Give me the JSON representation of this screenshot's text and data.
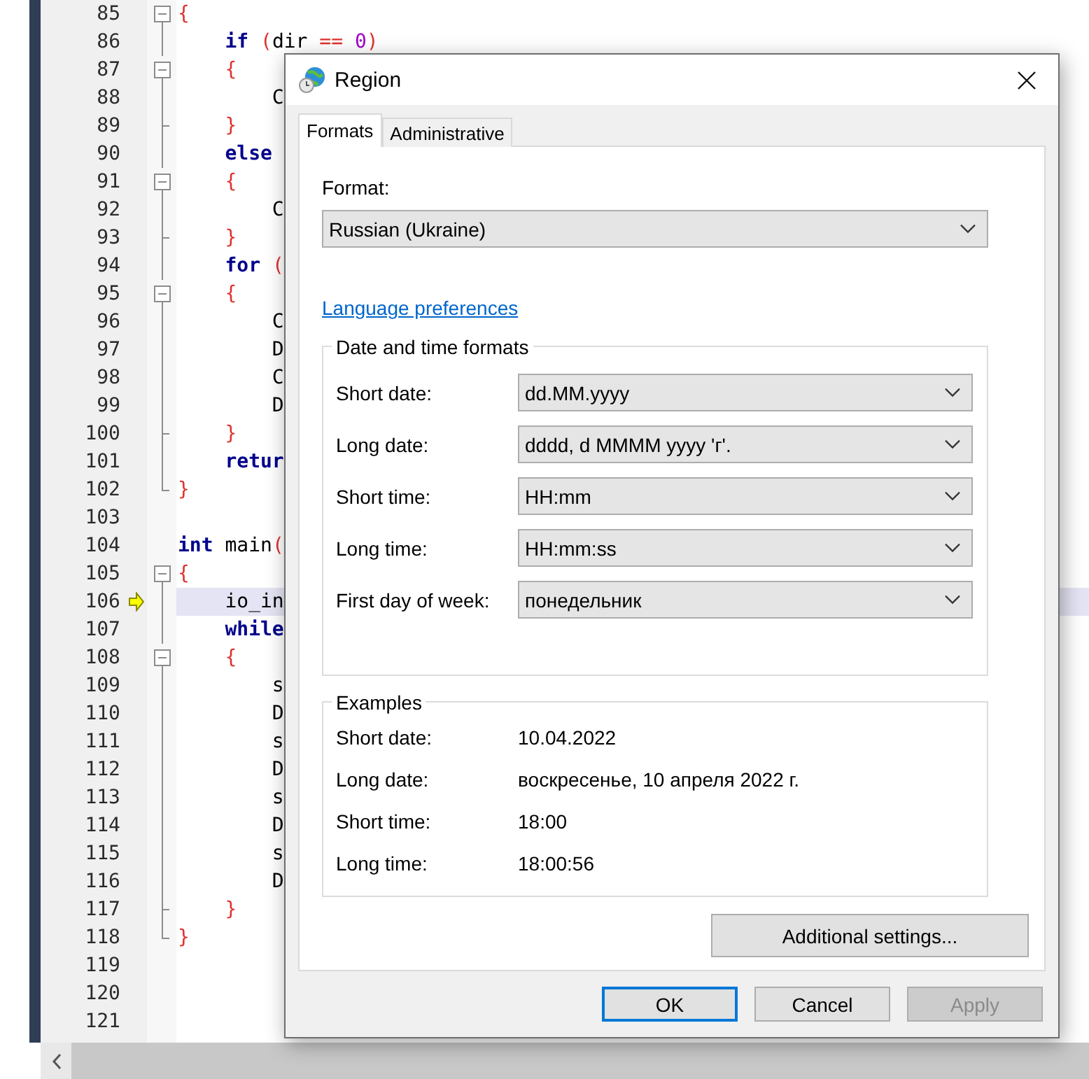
{
  "editor": {
    "lines": [
      {
        "number": "85",
        "current": false,
        "fold": {
          "kind": "start"
        },
        "tokens": [
          {
            "text": "{",
            "kind": "brace"
          }
        ]
      },
      {
        "number": "86",
        "current": false,
        "fold": {
          "kind": "mid"
        },
        "tokens": [
          {
            "text": "    if",
            "kind": "keyword"
          },
          {
            "text": " (",
            "kind": "brace"
          },
          {
            "text": "dir",
            "kind": "plain"
          },
          {
            "text": " ==",
            "kind": "brace"
          },
          {
            "text": " 0",
            "kind": "number"
          },
          {
            "text": ")",
            "kind": "brace"
          }
        ]
      },
      {
        "number": "87",
        "current": false,
        "fold": {
          "kind": "start"
        },
        "tokens": [
          {
            "text": "    {",
            "kind": "brace"
          }
        ]
      },
      {
        "number": "88",
        "current": false,
        "fold": {
          "kind": "mid"
        },
        "tokens": [
          {
            "text": "        C",
            "kind": "plain"
          }
        ]
      },
      {
        "number": "89",
        "current": false,
        "fold": {
          "kind": "end"
        },
        "tokens": [
          {
            "text": "    }",
            "kind": "brace"
          }
        ]
      },
      {
        "number": "90",
        "current": false,
        "fold": {
          "kind": "mid"
        },
        "tokens": [
          {
            "text": "    else",
            "kind": "keyword"
          }
        ]
      },
      {
        "number": "91",
        "current": false,
        "fold": {
          "kind": "start"
        },
        "tokens": [
          {
            "text": "    {",
            "kind": "brace"
          }
        ]
      },
      {
        "number": "92",
        "current": false,
        "fold": {
          "kind": "mid"
        },
        "tokens": [
          {
            "text": "        C",
            "kind": "plain"
          }
        ]
      },
      {
        "number": "93",
        "current": false,
        "fold": {
          "kind": "end"
        },
        "tokens": [
          {
            "text": "    }",
            "kind": "brace"
          }
        ]
      },
      {
        "number": "94",
        "current": false,
        "fold": {
          "kind": "mid"
        },
        "tokens": [
          {
            "text": "    for",
            "kind": "keyword"
          },
          {
            "text": " (",
            "kind": "brace"
          }
        ]
      },
      {
        "number": "95",
        "current": false,
        "fold": {
          "kind": "start"
        },
        "tokens": [
          {
            "text": "    {",
            "kind": "brace"
          }
        ]
      },
      {
        "number": "96",
        "current": false,
        "fold": {
          "kind": "mid"
        },
        "tokens": [
          {
            "text": "        C",
            "kind": "plain"
          }
        ]
      },
      {
        "number": "97",
        "current": false,
        "fold": {
          "kind": "mid"
        },
        "tokens": [
          {
            "text": "        D",
            "kind": "plain"
          }
        ]
      },
      {
        "number": "98",
        "current": false,
        "fold": {
          "kind": "mid"
        },
        "tokens": [
          {
            "text": "        C",
            "kind": "plain"
          }
        ]
      },
      {
        "number": "99",
        "current": false,
        "fold": {
          "kind": "mid"
        },
        "tokens": [
          {
            "text": "        D",
            "kind": "plain"
          }
        ]
      },
      {
        "number": "100",
        "current": false,
        "fold": {
          "kind": "end"
        },
        "tokens": [
          {
            "text": "    }",
            "kind": "brace"
          }
        ]
      },
      {
        "number": "101",
        "current": false,
        "fold": {
          "kind": "mid"
        },
        "tokens": [
          {
            "text": "    retur",
            "kind": "keyword"
          }
        ]
      },
      {
        "number": "102",
        "current": false,
        "fold": {
          "kind": "last"
        },
        "tokens": [
          {
            "text": "}",
            "kind": "brace"
          }
        ]
      },
      {
        "number": "103",
        "current": false
      },
      {
        "number": "104",
        "current": false,
        "tokens": [
          {
            "text": "int",
            "kind": "keyword"
          },
          {
            "text": " main",
            "kind": "plain"
          },
          {
            "text": "(",
            "kind": "brace"
          }
        ]
      },
      {
        "number": "105",
        "current": false,
        "fold": {
          "kind": "start"
        },
        "tokens": [
          {
            "text": "{",
            "kind": "brace"
          }
        ]
      },
      {
        "number": "106",
        "current": true,
        "fold": {
          "kind": "mid"
        },
        "tokens": [
          {
            "text": "    io_in",
            "kind": "plain"
          }
        ]
      },
      {
        "number": "107",
        "current": false,
        "fold": {
          "kind": "mid"
        },
        "tokens": [
          {
            "text": "    while",
            "kind": "keyword"
          }
        ]
      },
      {
        "number": "108",
        "current": false,
        "fold": {
          "kind": "start"
        },
        "tokens": [
          {
            "text": "    {",
            "kind": "brace"
          }
        ]
      },
      {
        "number": "109",
        "current": false,
        "fold": {
          "kind": "mid"
        },
        "tokens": [
          {
            "text": "        s",
            "kind": "plain"
          }
        ]
      },
      {
        "number": "110",
        "current": false,
        "fold": {
          "kind": "mid"
        },
        "tokens": [
          {
            "text": "        D",
            "kind": "plain"
          }
        ]
      },
      {
        "number": "111",
        "current": false,
        "fold": {
          "kind": "mid"
        },
        "tokens": [
          {
            "text": "        s",
            "kind": "plain"
          }
        ]
      },
      {
        "number": "112",
        "current": false,
        "fold": {
          "kind": "mid"
        },
        "tokens": [
          {
            "text": "        D",
            "kind": "plain"
          }
        ]
      },
      {
        "number": "113",
        "current": false,
        "fold": {
          "kind": "mid"
        },
        "tokens": [
          {
            "text": "        s",
            "kind": "plain"
          }
        ]
      },
      {
        "number": "114",
        "current": false,
        "fold": {
          "kind": "mid"
        },
        "tokens": [
          {
            "text": "        D",
            "kind": "plain"
          }
        ]
      },
      {
        "number": "115",
        "current": false,
        "fold": {
          "kind": "mid"
        },
        "tokens": [
          {
            "text": "        s",
            "kind": "plain"
          }
        ]
      },
      {
        "number": "116",
        "current": false,
        "fold": {
          "kind": "mid"
        },
        "tokens": [
          {
            "text": "        D",
            "kind": "plain"
          }
        ]
      },
      {
        "number": "117",
        "current": false,
        "fold": {
          "kind": "end"
        },
        "tokens": [
          {
            "text": "    }",
            "kind": "brace"
          }
        ]
      },
      {
        "number": "118",
        "current": false,
        "fold": {
          "kind": "last"
        },
        "tokens": [
          {
            "text": "}",
            "kind": "brace"
          }
        ]
      },
      {
        "number": "119",
        "current": false
      },
      {
        "number": "120",
        "current": false
      },
      {
        "number": "121",
        "current": false
      }
    ]
  },
  "dialog": {
    "title": "Region",
    "tabs": [
      {
        "label": "Formats",
        "selected": true
      },
      {
        "label": "Administrative",
        "selected": false
      }
    ],
    "format": {
      "label": "Format:",
      "value": "Russian (Ukraine)"
    },
    "link": "Language preferences",
    "formats_group": {
      "title": "Date and time formats",
      "rows": [
        {
          "label": "Short date:",
          "value": "dd.MM.yyyy"
        },
        {
          "label": "Long date:",
          "value": "dddd, d MMMM yyyy 'г'."
        },
        {
          "label": "Short time:",
          "value": "HH:mm"
        },
        {
          "label": "Long time:",
          "value": "HH:mm:ss"
        },
        {
          "label": "First day of week:",
          "value": "понедельник"
        }
      ]
    },
    "examples_group": {
      "title": "Examples",
      "rows": [
        {
          "label": "Short date:",
          "value": "10.04.2022"
        },
        {
          "label": "Long date:",
          "value": "воскресенье, 10 апреля 2022 г."
        },
        {
          "label": "Short time:",
          "value": "18:00"
        },
        {
          "label": "Long time:",
          "value": "18:00:56"
        }
      ]
    },
    "additional": "Additional settings...",
    "buttons": [
      {
        "label": "OK",
        "default": true,
        "disabled": false
      },
      {
        "label": "Cancel",
        "default": false,
        "disabled": false
      },
      {
        "label": "Apply",
        "default": false,
        "disabled": true
      }
    ]
  }
}
